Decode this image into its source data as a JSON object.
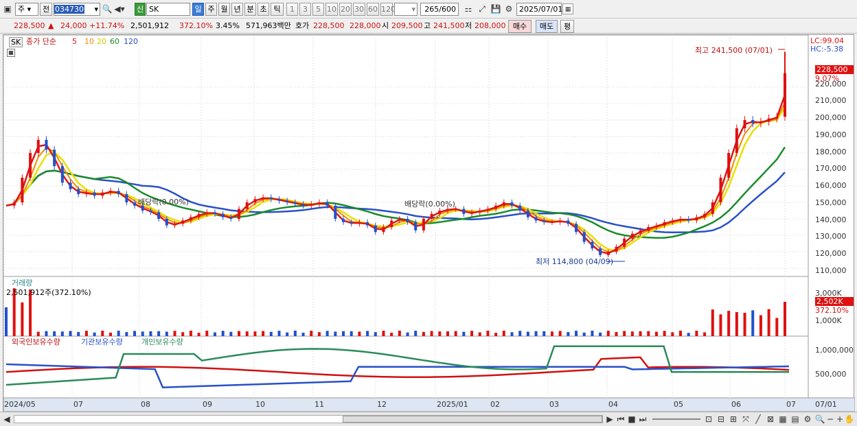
{
  "toolbar": {
    "period_combo": "주",
    "prev_label": "전",
    "code": "034730",
    "stock_name": "SK",
    "new_badge": "신",
    "period_tabs": [
      "일",
      "주",
      "월",
      "년",
      "분",
      "초",
      "틱"
    ],
    "intervals": [
      "1",
      "3",
      "5",
      "10",
      "20",
      "30",
      "60",
      "120"
    ],
    "count": "265",
    "count_max": "/600",
    "date": "2025/07/01"
  },
  "quote": {
    "price": "228,500",
    "arrow": "▲",
    "change": "24,000",
    "change_pct": "+11.74%",
    "volume": "2,501,912",
    "volume_ratio": "372.10%",
    "turnover": "3.45%",
    "amount": "571,963백만",
    "bid_label": "호가",
    "ask": "228,500",
    "bid": "228,000",
    "open_label": "시",
    "open": "209,500",
    "high_label": "고",
    "high": "241,500",
    "low_label": "저",
    "low": "208,000",
    "buy_label": "매수",
    "sell_label": "매도",
    "eval_label": "평"
  },
  "price_panel": {
    "legend_stock": "SK",
    "legend_title": "종가 단순",
    "ma": [
      {
        "period": "5",
        "color": "#d81818"
      },
      {
        "period": "10",
        "color": "#f08a00"
      },
      {
        "period": "20",
        "color": "#e8e000"
      },
      {
        "period": "60",
        "color": "#1a8a2a"
      },
      {
        "period": "120",
        "color": "#2850c8"
      }
    ],
    "lc": "LC:99.04",
    "hc": "HC:-5.38",
    "high_note": "최고 241,500 (07/01)",
    "low_note": "최저 114,800 (04/09)",
    "div1": "배당락(0.00%)",
    "div2": "배당락(0.00%)",
    "last_price": "228,500",
    "last_pct": "9.07%",
    "y_ticks": [
      "220,000",
      "210,000",
      "200,000",
      "190,000",
      "180,000",
      "170,000",
      "160,000",
      "150,000",
      "140,000",
      "130,000",
      "120,000",
      "110,000"
    ]
  },
  "volume_panel": {
    "title": "거래량",
    "value": "2,501,912주(372.10%)",
    "y_ticks": [
      "3,000K",
      "1,000K"
    ],
    "last": "2,502K",
    "last_pct": "372.10%"
  },
  "holdings_panel": {
    "foreign": "외국인보유수량",
    "inst": "기관보유수량",
    "indiv": "개인보유수량",
    "y_ticks": [
      "1,000,000",
      "500,000"
    ]
  },
  "x_axis": [
    "2024/05",
    "07",
    "08",
    "09",
    "10",
    "11",
    "12",
    "2025/01",
    "02",
    "03",
    "04",
    "05",
    "06",
    "07",
    "07/01"
  ],
  "chart_data": {
    "type": "line",
    "ylim": [
      105000,
      245000
    ],
    "x_start": "2024/05",
    "x_end": "2025/07/01",
    "close": [
      148000,
      150000,
      165000,
      180000,
      188000,
      182000,
      172000,
      162000,
      158000,
      155000,
      156000,
      154000,
      156000,
      157000,
      155000,
      150000,
      148000,
      145000,
      144000,
      140000,
      136000,
      137000,
      139000,
      141000,
      143000,
      144000,
      143000,
      141000,
      140000,
      146000,
      150000,
      152000,
      153000,
      152000,
      151000,
      150000,
      149000,
      148000,
      149000,
      150000,
      148000,
      140000,
      138000,
      137000,
      138000,
      136000,
      132000,
      135000,
      139000,
      140000,
      138000,
      133000,
      140000,
      143000,
      145000,
      146000,
      146000,
      143000,
      144000,
      145000,
      146000,
      148000,
      150000,
      148000,
      145000,
      141000,
      139000,
      138000,
      138000,
      139000,
      137000,
      132000,
      126000,
      122000,
      118000,
      120000,
      123000,
      128000,
      131000,
      133000,
      135000,
      136000,
      138000,
      139000,
      140000,
      139000,
      141000,
      143000,
      150000,
      165000,
      180000,
      195000,
      200000,
      198000,
      199000,
      201000,
      202000,
      228500
    ],
    "high_value": 241500,
    "low_value": 114800
  }
}
